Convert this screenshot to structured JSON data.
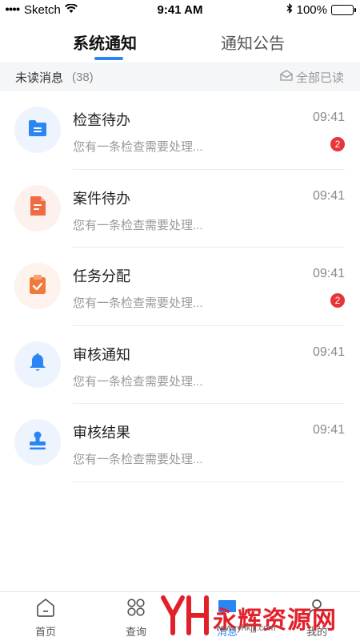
{
  "status_bar": {
    "carrier": "Sketch",
    "time": "9:41 AM",
    "battery": "100%"
  },
  "tabs": [
    {
      "label": "系统通知",
      "active": true
    },
    {
      "label": "通知公告",
      "active": false
    }
  ],
  "unread": {
    "label": "未读消息",
    "count": "(38)",
    "mark_all_label": "全部已读"
  },
  "messages": [
    {
      "title": "检查待办",
      "time": "09:41",
      "desc": "您有一条检查需要处理...",
      "badge": "2",
      "icon": "folder-doc-icon",
      "icon_color": "#2b86f5",
      "bg": "#eef4fd"
    },
    {
      "title": "案件待办",
      "time": "09:41",
      "desc": "您有一条检查需要处理...",
      "badge": "",
      "icon": "document-icon",
      "icon_color": "#ef6a45",
      "bg": "#fdf1ee"
    },
    {
      "title": "任务分配",
      "time": "09:41",
      "desc": "您有一条检查需要处理...",
      "badge": "2",
      "icon": "clipboard-check-icon",
      "icon_color": "#f07a3c",
      "bg": "#fdf2ec"
    },
    {
      "title": "审核通知",
      "time": "09:41",
      "desc": "您有一条检查需要处理...",
      "badge": "",
      "icon": "bell-icon",
      "icon_color": "#2b86f5",
      "bg": "#eef4fd"
    },
    {
      "title": "审核结果",
      "time": "09:41",
      "desc": "您有一条检查需要处理...",
      "badge": "",
      "icon": "stamp-icon",
      "icon_color": "#2b86f5",
      "bg": "#eef4fd"
    }
  ],
  "bottom_nav": [
    {
      "label": "首页",
      "icon": "home-icon"
    },
    {
      "label": "查询",
      "icon": "grid-icon"
    },
    {
      "label": "消息",
      "icon": "message-icon"
    },
    {
      "label": "我的",
      "icon": "user-icon"
    }
  ],
  "watermark": {
    "text": "永辉资源网",
    "url": "www.yhkjjj.com"
  }
}
